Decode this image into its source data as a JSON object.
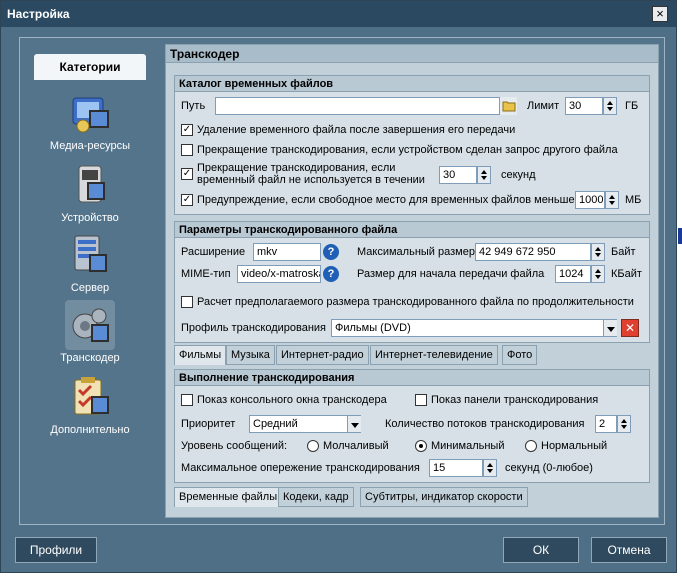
{
  "window": {
    "title": "Настройка"
  },
  "categories": {
    "header": "Категории",
    "items": [
      {
        "label": "Медиа-ресурсы",
        "icon": "media-resources-icon"
      },
      {
        "label": "Устройство",
        "icon": "device-icon"
      },
      {
        "label": "Сервер",
        "icon": "server-icon"
      },
      {
        "label": "Транскодер",
        "icon": "transcoder-icon"
      },
      {
        "label": "Дополнительно",
        "icon": "additional-icon"
      }
    ],
    "selected": "Транскодер"
  },
  "main": {
    "title": "Транскодер",
    "temp_catalog": {
      "title": "Каталог временных файлов",
      "path_label": "Путь",
      "path_value": "",
      "limit_label": "Лимит",
      "limit_value": "30",
      "limit_unit": "ГБ",
      "delete_after": {
        "label": "Удаление временного файла после завершения его передачи",
        "checked": true
      },
      "stop_on_other": {
        "label": "Прекращение транскодирования, если устройством сделан запрос другого файла",
        "checked": false
      },
      "stop_unused": {
        "label_line1": "Прекращение транскодирования, если",
        "label_line2": "временный файл не используется в течении",
        "value": "30",
        "unit": "секунд",
        "checked": true
      },
      "warn_free": {
        "label": "Предупреждение, если свободное место для временных файлов меньше",
        "value": "1000",
        "unit": "МБ",
        "checked": true
      }
    },
    "transcoded_params": {
      "title": "Параметры транскодированного файла",
      "ext_label": "Расширение",
      "ext_value": "mkv",
      "mime_label": "MIME-тип",
      "mime_value": "video/x-matroska",
      "max_size_label": "Максимальный размер",
      "max_size_value": "42 949 672 950",
      "max_size_unit": "Байт",
      "start_size_label": "Размер для начала передачи файла",
      "start_size_value": "1024",
      "start_size_unit": "КБайт",
      "calc_size": {
        "label": "Расчет предполагаемого размера транскодированного файла по продолжительности",
        "checked": false
      },
      "profile_label": "Профиль транскодирования",
      "profile_value": "Фильмы (DVD)"
    },
    "profile_tabs": [
      "Фильмы",
      "Музыка",
      "Интернет-радио",
      "Интернет-телевидение",
      "Фото"
    ],
    "execution": {
      "title": "Выполнение транскодирования",
      "show_console": {
        "label": "Показ консольного окна транскодера",
        "checked": false
      },
      "show_panel": {
        "label": "Показ панели транскодирования",
        "checked": false
      },
      "priority_label": "Приоритет",
      "priority_value": "Средний",
      "threads_label": "Количество потоков транскодирования",
      "threads_value": "2",
      "msg_level_label": "Уровень сообщений:",
      "msg_levels": [
        "Молчаливый",
        "Минимальный",
        "Нормальный"
      ],
      "msg_level_selected": "Минимальный",
      "max_ahead_label": "Максимальное опережение транскодирования",
      "max_ahead_value": "15",
      "max_ahead_unit": "секунд (0-любое)"
    },
    "bottom_tabs": [
      "Временные файлы",
      "Кодеки, кадр",
      "Субтитры, индикатор скорости"
    ]
  },
  "buttons": {
    "profiles": "Профили",
    "ok": "ОК",
    "cancel": "Отмена"
  },
  "colors": {
    "window_bg": "#4f6f86",
    "titlebar": "#2b4a61",
    "panel": "#c2d0d9",
    "group": "#d6e0e6"
  }
}
